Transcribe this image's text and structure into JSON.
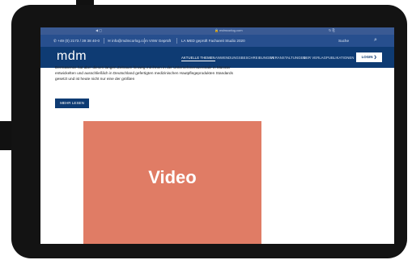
{
  "browser": {
    "nav_icons": "◀  ▢",
    "url": "🔒 mdmcorlog.com",
    "end_icons": "↻  ⎘"
  },
  "topbar": {
    "phone": "✆ +49 (0) 2173 / 39 38 40-0",
    "email": "✉ info@mdmcorlog.com",
    "tag1": "VSW Geprüft",
    "tag2": "LA MED geprüft Fachareit Studio 2020",
    "search": "Suche",
    "search_icon": "⌕"
  },
  "nav": {
    "logo": "mdm",
    "links": [
      "AKTUELLE THEMEN",
      "ANWENDUNGSBESCHREIBUNGEN",
      "VERANSTALTUNGEN",
      "DER VERLAG",
      "PUBLIKATIONEN"
    ],
    "login": "LOGIN ❯"
  },
  "article": {
    "line0": "Dermasence hat aber diesen langen Zeitraum hinweg mit ihnen in der Unternehmenszentrale in Münster",
    "line1": "entwickelten und ausschließlich in Deutschland gefertigten medizinischen Hautpflegeprodukten Standards",
    "line2": "gesetzt und ist heute nicht nur eine der größten",
    "read_more": "MEHR LESEN"
  },
  "video": {
    "label": "Video"
  },
  "colors": {
    "navy": "#0e3b73",
    "topbar": "#274f8e",
    "video": "#e07c65",
    "bezel": "#131313"
  }
}
